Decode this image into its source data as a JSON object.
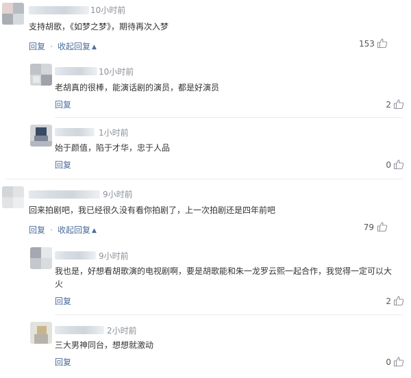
{
  "comments": [
    {
      "time": "10小时前",
      "text": "支持胡歌，《如梦之梦》，期待再次入梦",
      "reply_label": "回复",
      "sep": "·",
      "collapse_label": "收起回复",
      "likes": "153",
      "replies": [
        {
          "time": "10小时前",
          "text": "老胡真的很棒，能演话剧的演员，都是好演员",
          "reply_label": "回复",
          "likes": "2"
        },
        {
          "time": "1小时前",
          "text": "始于颜值，陷于才华，忠于人品",
          "reply_label": "回复",
          "likes": "0"
        }
      ]
    },
    {
      "time": "9小时前",
      "text": "回来拍剧吧，我已经很久没有看你拍剧了，上一次拍剧还是四年前吧",
      "reply_label": "回复",
      "sep": "·",
      "collapse_label": "收起回复",
      "likes": "79",
      "replies": [
        {
          "time": "9小时前",
          "text_line1": "我也是，好想看胡歌演的电视剧啊，要是胡歌能和朱一龙罗云熙一起合作，我觉得一定可以大",
          "text_line2": "火",
          "reply_label": "回复",
          "likes": "2"
        },
        {
          "time": "2小时前",
          "text": "三大男神同台，想想就激动",
          "reply_label": "回复",
          "likes": "0"
        }
      ]
    }
  ],
  "icons": {
    "thumb": "thumbs-up-icon",
    "caret": "caret-up-icon"
  }
}
